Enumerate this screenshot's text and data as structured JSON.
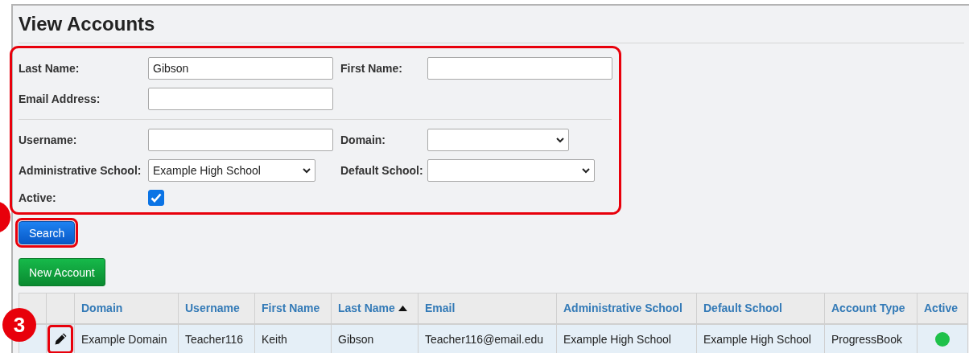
{
  "title": "View Accounts",
  "filters": {
    "highlighted": true,
    "groups": [
      {
        "rows": [
          [
            {
              "label": "Last Name:",
              "kind": "text",
              "value": "Gibson"
            },
            {
              "label": "First Name:",
              "kind": "text"
            }
          ],
          [
            {
              "label": "Email Address:",
              "kind": "text"
            }
          ]
        ]
      },
      {
        "rows": [
          [
            {
              "label": "Username:",
              "kind": "text"
            },
            {
              "label": "Domain:",
              "kind": "select"
            }
          ],
          [
            {
              "label": "Administrative School:",
              "kind": "select",
              "value": "Example High School"
            },
            {
              "label": "Default School:",
              "kind": "select"
            }
          ],
          [
            {
              "label": "Active:",
              "kind": "checkbox",
              "checked": true
            }
          ]
        ]
      }
    ]
  },
  "search_button": {
    "label": "Search",
    "highlighted": true,
    "callout": true
  },
  "new_account_button": {
    "label": "New Account"
  },
  "table": {
    "columns": [
      {
        "label": "Domain",
        "sorted": false
      },
      {
        "label": "Username",
        "sorted": false
      },
      {
        "label": "First Name",
        "sorted": false
      },
      {
        "label": "Last Name",
        "sorted": true
      },
      {
        "label": "Email",
        "sorted": false
      },
      {
        "label": "Administrative School",
        "sorted": false
      },
      {
        "label": "Default School",
        "sorted": false
      },
      {
        "label": "Account Type",
        "sorted": false
      },
      {
        "label": "Active",
        "sorted": false
      }
    ],
    "rows": [
      {
        "cells": [
          "Example Domain",
          "Teacher116",
          "Keith",
          "Gibson",
          "Teacher116@email.edu",
          "Example High School",
          "Example High School",
          "ProgressBook"
        ],
        "active": true,
        "edit_highlighted": true,
        "callout": "3"
      }
    ]
  }
}
